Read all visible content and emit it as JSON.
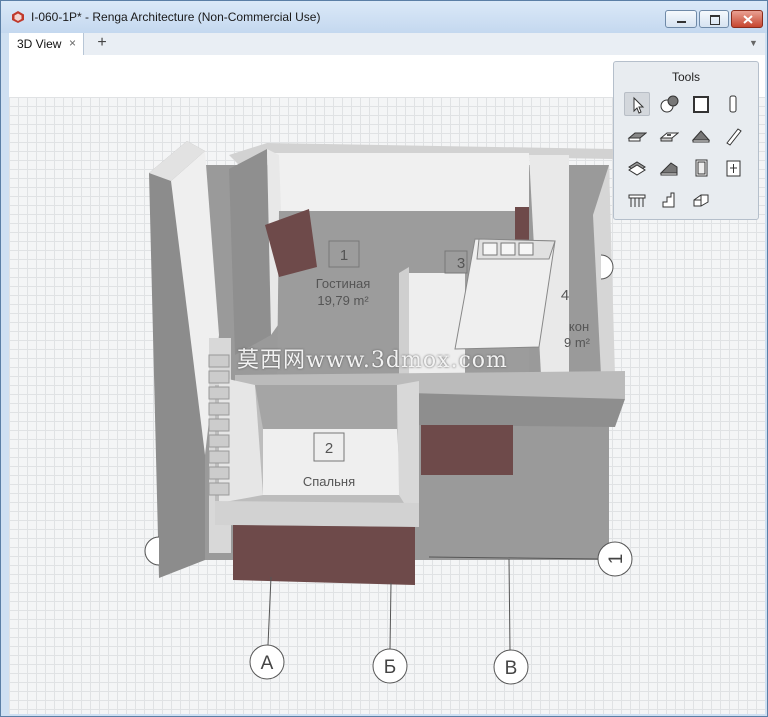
{
  "window": {
    "title": "I-060-1P* - Renga Architecture (Non-Commercial Use)"
  },
  "tabs": [
    {
      "label": "3D View",
      "close": "×"
    }
  ],
  "tabbar": {
    "add": "+",
    "menu": "▼"
  },
  "tools_panel": {
    "title": "Tools",
    "items": [
      "select-tool-icon",
      "annotation-tool-icon",
      "wall-tool-icon",
      "column-tool-icon",
      "floor-tool-icon",
      "opening-tool-icon",
      "roof-tool-icon",
      "beam-tool-icon",
      "slab-tool-icon",
      "ramp-tool-icon",
      "door-tool-icon",
      "window-tool-icon",
      "railing-tool-icon",
      "stair-tool-icon",
      "element-tool-icon"
    ]
  },
  "rooms": [
    {
      "number": "1",
      "name": "Гостиная",
      "area": "19,79 m²"
    },
    {
      "number": "2",
      "name": "Спальня"
    },
    {
      "number": "3"
    },
    {
      "number": "4",
      "name": "кон",
      "area": "9 m²"
    }
  ],
  "axes": [
    "А",
    "Б",
    "В",
    "1"
  ],
  "watermark": "莫西网www.3dmox.com",
  "colors": {
    "wall": "#8c8c8c",
    "door": "#6e4a4a",
    "floor": "#8f8f8f",
    "wall_top": "#e6e6e6"
  }
}
